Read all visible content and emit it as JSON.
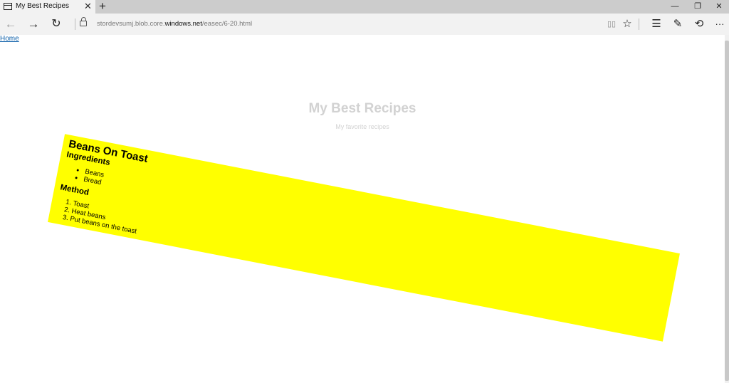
{
  "browser": {
    "tab_title": "My Best Recipes",
    "tab_close": "✕",
    "new_tab": "+",
    "window_controls": {
      "minimize": "—",
      "restore": "❐",
      "close": "✕"
    },
    "address": {
      "prefix": "stordevsumj.blob.core.",
      "host": "windows.net",
      "path": "/easec/6-20.html"
    },
    "nav_icons": {
      "back": "←",
      "forward": "→",
      "refresh": "↻"
    },
    "toolbar_icons": {
      "reading_view": "▯▯",
      "favorite": "☆",
      "hub": "☰",
      "notes": "✎",
      "share": "⟲",
      "more": "···"
    }
  },
  "page": {
    "home_link": "Home",
    "site_title": "My Best Recipes",
    "site_subtitle": "My favorite recipes",
    "recipe": {
      "title": "Beans On Toast",
      "ingredients_heading": "Ingredients",
      "ingredients": [
        "Beans",
        "Bread"
      ],
      "method_heading": "Method",
      "method": [
        "Toast",
        "Heat beans",
        "Put beans on the toast"
      ],
      "background": "#ffff00"
    }
  }
}
